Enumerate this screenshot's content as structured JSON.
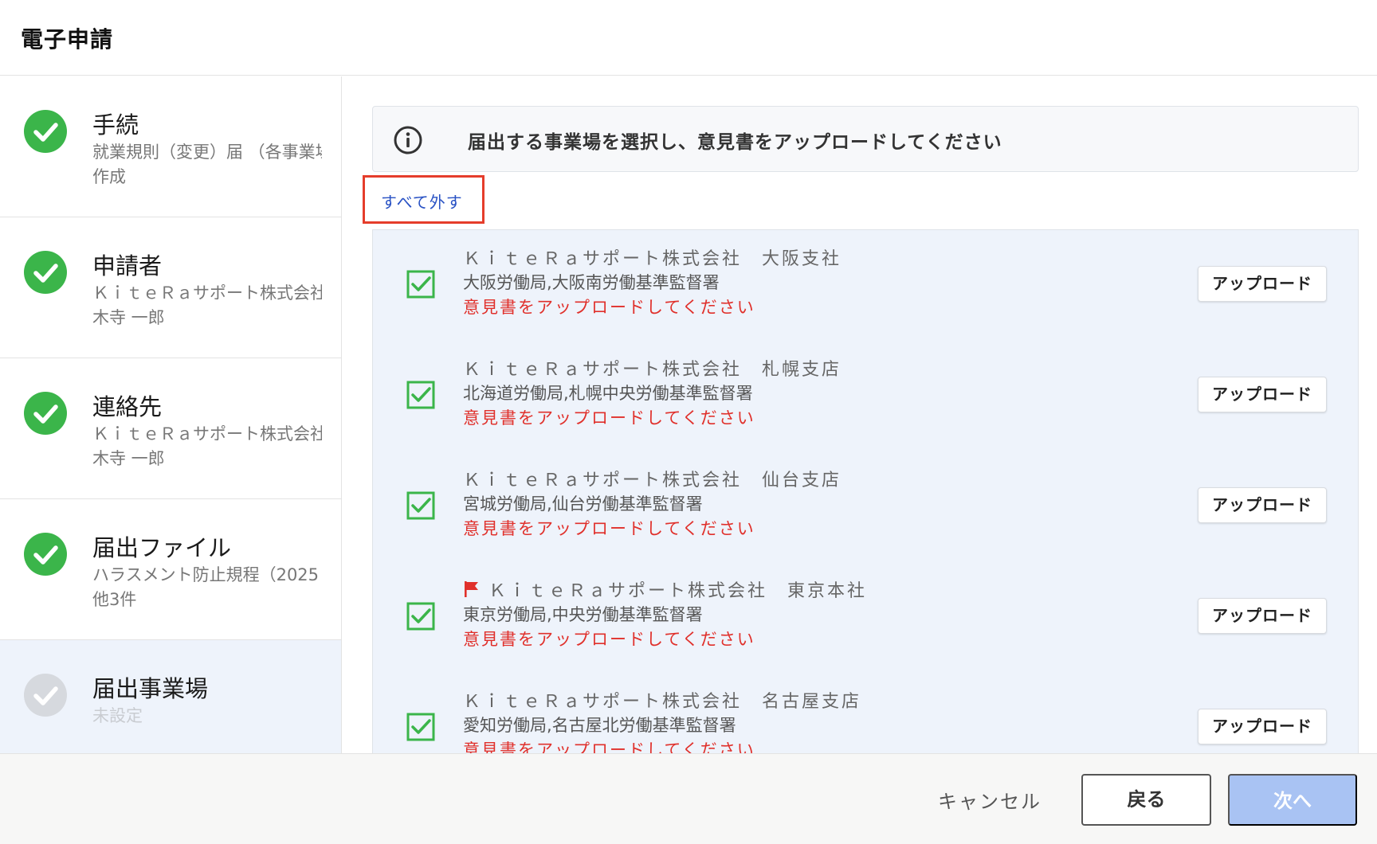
{
  "header": {
    "title": "電子申請"
  },
  "sidebar": {
    "steps": [
      {
        "title": "手続",
        "sub1": "就業規則（変更）届 （各事業場",
        "sub2": "作成",
        "status": "complete"
      },
      {
        "title": "申請者",
        "sub1": "ＫｉｔｅＲａサポート株式会社",
        "sub2": "木寺 一郎",
        "status": "complete"
      },
      {
        "title": "連絡先",
        "sub1": "ＫｉｔｅＲａサポート株式会社",
        "sub2": "木寺 一郎",
        "status": "complete"
      },
      {
        "title": "届出ファイル",
        "sub1": "ハラスメント防止規程（2025",
        "sub2": "他3件",
        "status": "complete"
      },
      {
        "title": "届出事業場",
        "sub1": "未設定",
        "sub2": "",
        "status": "current"
      }
    ]
  },
  "main": {
    "info_text": "届出する事業場を選択し、意見書をアップロードしてください",
    "deselect_all": "すべて外す",
    "offices": [
      {
        "name": "ＫｉｔｅＲａサポート株式会社　大阪支社",
        "bureau": "大阪労働局,大阪南労働基準監督署",
        "warning": "意見書をアップロードしてください",
        "upload_label": "アップロード",
        "checked": true,
        "flag": false
      },
      {
        "name": "ＫｉｔｅＲａサポート株式会社　札幌支店",
        "bureau": "北海道労働局,札幌中央労働基準監督署",
        "warning": "意見書をアップロードしてください",
        "upload_label": "アップロード",
        "checked": true,
        "flag": false
      },
      {
        "name": "ＫｉｔｅＲａサポート株式会社　仙台支店",
        "bureau": "宮城労働局,仙台労働基準監督署",
        "warning": "意見書をアップロードしてください",
        "upload_label": "アップロード",
        "checked": true,
        "flag": false
      },
      {
        "name": "ＫｉｔｅＲａサポート株式会社　東京本社",
        "bureau": "東京労働局,中央労働基準監督署",
        "warning": "意見書をアップロードしてください",
        "upload_label": "アップロード",
        "checked": true,
        "flag": true
      },
      {
        "name": "ＫｉｔｅＲａサポート株式会社　名古屋支店",
        "bureau": "愛知労働局,名古屋北労働基準監督署",
        "warning": "意見書をアップロードしてください",
        "upload_label": "アップロード",
        "checked": true,
        "flag": false
      }
    ]
  },
  "footer": {
    "cancel": "キャンセル",
    "back": "戻る",
    "next": "次へ"
  },
  "colors": {
    "success": "#3bb54a",
    "pending": "#d6d9de",
    "warning": "#e0302b",
    "link": "#2952c4",
    "highlight_border": "#e53d2b",
    "next_disabled": "#a9c3f3",
    "checkbox": "#3bb54a",
    "flag": "#e0302b"
  },
  "icons": {
    "step_complete": "check-circle-icon",
    "step_pending": "check-circle-icon",
    "info": "info-icon",
    "checkbox": "checkbox-checked-icon",
    "flag": "flag-icon"
  }
}
